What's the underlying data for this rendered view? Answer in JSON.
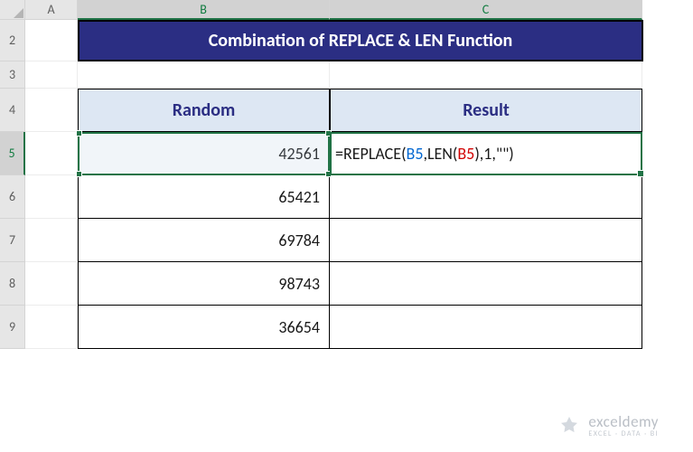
{
  "columns": {
    "A": "A",
    "B": "B",
    "C": "C"
  },
  "rows": {
    "r2": "2",
    "r3": "3",
    "r4": "4",
    "r5": "5",
    "r6": "6",
    "r7": "7",
    "r8": "8",
    "r9": "9"
  },
  "title": "Combination of REPLACE & LEN Function",
  "headers": {
    "random": "Random",
    "result": "Result"
  },
  "data": {
    "b5": "42561",
    "b6": "65421",
    "b7": "69784",
    "b8": "98743",
    "b9": "36654"
  },
  "formula": {
    "prefix": "=REPLACE(",
    "ref1": "B5",
    "mid1": ",LEN(",
    "ref2": "B5",
    "mid2": "),1,\"\")"
  },
  "chart_data": {
    "type": "table",
    "title": "Combination of REPLACE & LEN Function",
    "columns": [
      "Random",
      "Result"
    ],
    "rows": [
      {
        "Random": 42561,
        "Result": "=REPLACE(B5,LEN(B5),1,\"\")"
      },
      {
        "Random": 65421,
        "Result": ""
      },
      {
        "Random": 69784,
        "Result": ""
      },
      {
        "Random": 98743,
        "Result": ""
      },
      {
        "Random": 36654,
        "Result": ""
      }
    ]
  },
  "watermark": {
    "brand": "exceldemy",
    "tagline": "EXCEL · DATA · BI"
  }
}
